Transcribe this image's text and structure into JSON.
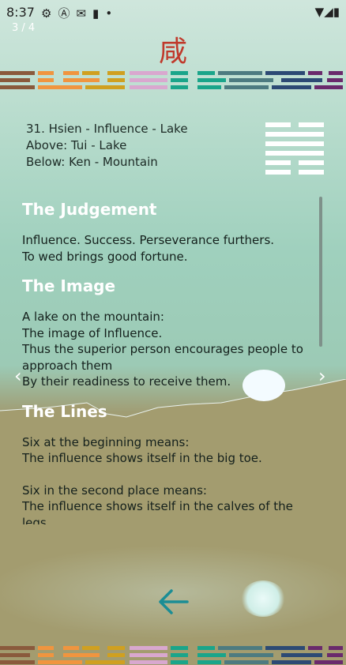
{
  "status_bar": {
    "time": "8:37",
    "left_icons": [
      "gear-icon",
      "a-circle-icon",
      "mail-icon",
      "clipboard-icon",
      "dot-icon"
    ],
    "right_icons": [
      "wifi-icon",
      "signal-icon",
      "battery-icon"
    ]
  },
  "page_indicator": "3 / 4",
  "hexagram_char": "咸",
  "info": {
    "line1": "31. Hsien - Influence  -  Lake",
    "line2": "Above:  Tui  -  Lake",
    "line3": "Below:  Ken  -  Mountain"
  },
  "hexagram_lines": [
    "broken",
    "solid",
    "solid",
    "solid",
    "broken",
    "broken"
  ],
  "sections": {
    "judgement_title": "The Judgement",
    "judgement_text": "Influence. Success. Perseverance furthers.\nTo wed brings good fortune.",
    "image_title": "The Image",
    "image_text": "A lake on the mountain:\nThe image of Influence.\nThus the superior person encourages people to approach them\nBy their readiness to receive them.",
    "lines_title": "The Lines",
    "line_1": "Six at the beginning means:\nThe influence shows itself in the big toe.",
    "line_2": "Six in the second place means:\nThe influence shows itself in the calves of the legs.\nMisfortune."
  },
  "nav": {
    "prev": "‹",
    "next": "›"
  },
  "colors": {
    "stripe_palette": [
      "#8a5a3c",
      "#f0953f",
      "#d0a020",
      "#d9a8cf",
      "#1aa58a",
      "#4d7b80",
      "#2c4a74",
      "#6a2a6c"
    ],
    "hanzi": "#c0392b",
    "back_arrow": "#1a8d95"
  }
}
